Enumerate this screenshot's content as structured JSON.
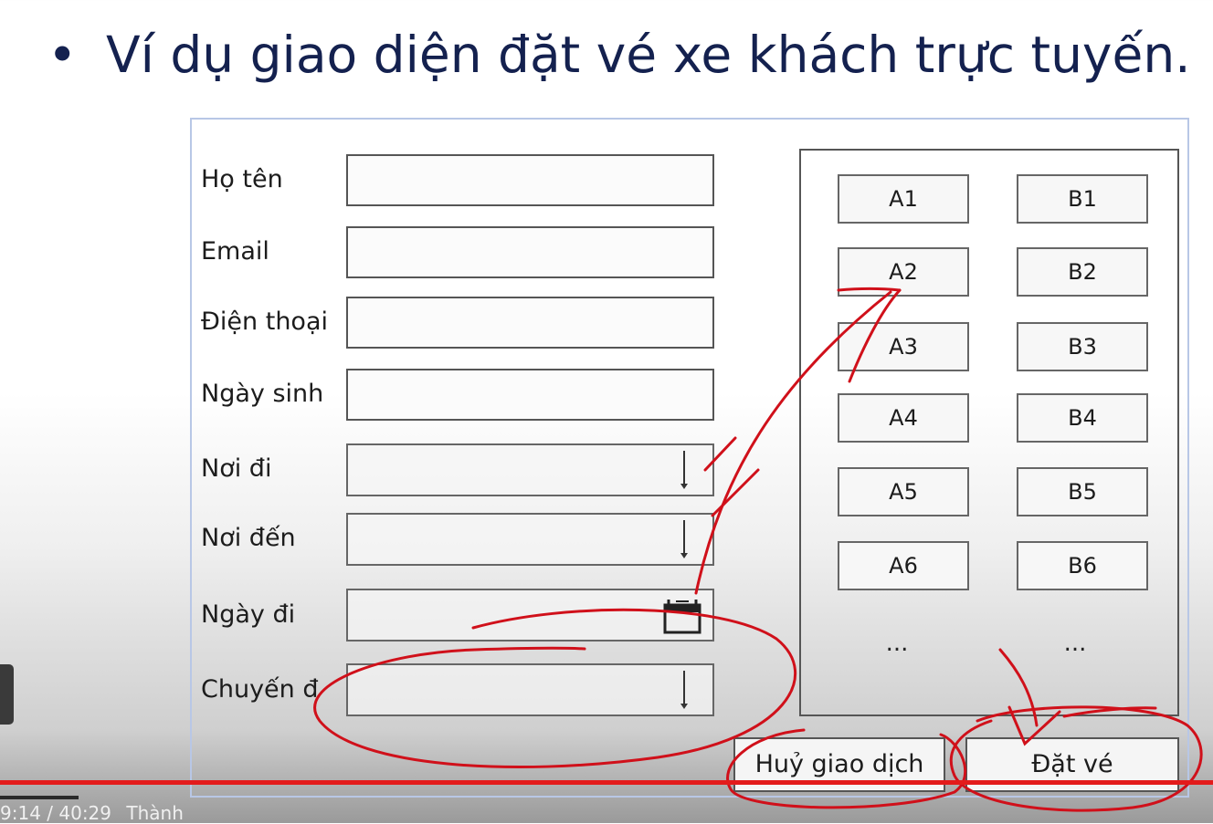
{
  "slide": {
    "bullet": "•",
    "title": "Ví dụ giao diện đặt vé xe khách trực tuyến."
  },
  "form": {
    "fields": [
      {
        "label": "Họ tên",
        "type": "text"
      },
      {
        "label": "Email",
        "type": "text"
      },
      {
        "label": "Điện thoại",
        "type": "text"
      },
      {
        "label": "Ngày sinh",
        "type": "text"
      },
      {
        "label": "Nơi đi",
        "type": "dropdown"
      },
      {
        "label": "Nơi đến",
        "type": "dropdown"
      },
      {
        "label": "Ngày đi",
        "type": "date"
      },
      {
        "label": "Chuyến đ",
        "type": "dropdown"
      }
    ],
    "seats": {
      "col_a": [
        "A1",
        "A2",
        "A3",
        "A4",
        "A5",
        "A6"
      ],
      "col_b": [
        "B1",
        "B2",
        "B3",
        "B4",
        "B5",
        "B6"
      ],
      "more": "..."
    },
    "buttons": {
      "cancel": "Huỷ giao dịch",
      "book": "Đặt vé"
    }
  },
  "player": {
    "time": "9:14 / 40:29",
    "progress": 0.227,
    "extra_text": "Thành"
  },
  "colors": {
    "title": "#14214f",
    "annotation": "#d0101a",
    "frame": "#b8c7e6"
  }
}
